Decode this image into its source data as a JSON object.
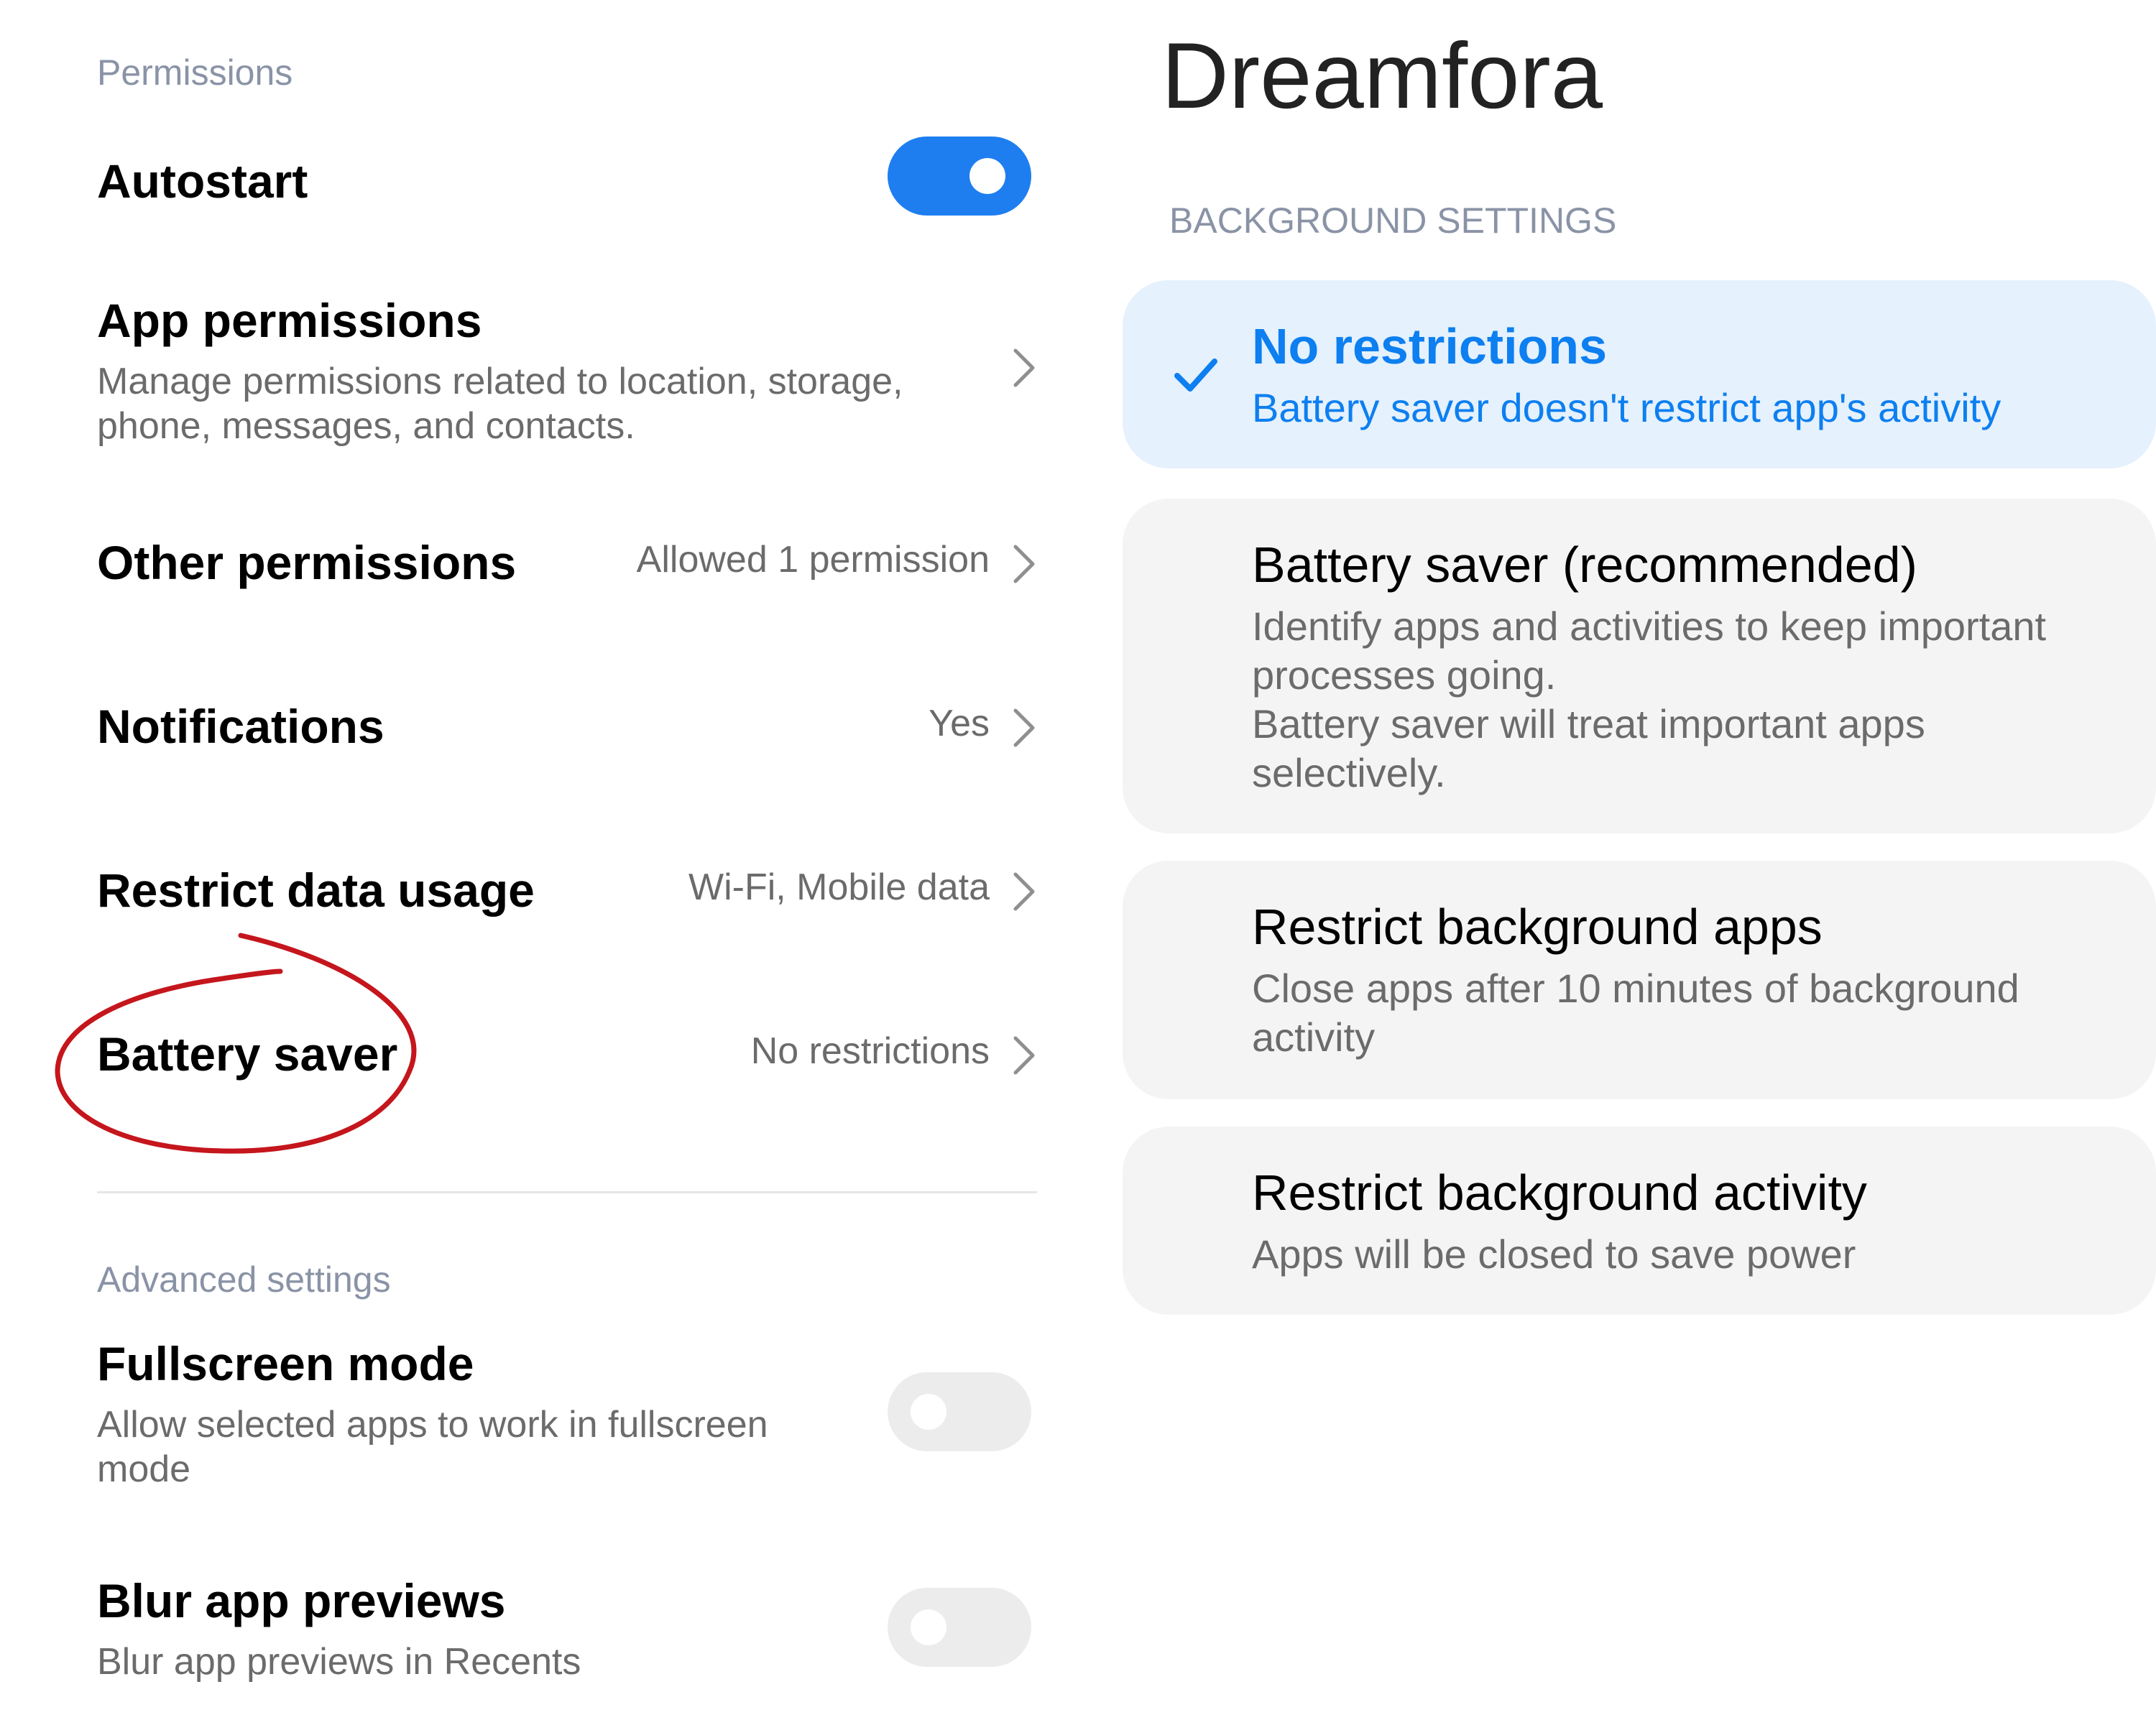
{
  "left": {
    "permissions_label": "Permissions",
    "autostart": {
      "title": "Autostart",
      "enabled": true
    },
    "app_permissions": {
      "title": "App permissions",
      "desc": "Manage permissions related to location, storage, phone, messages, and contacts."
    },
    "other_permissions": {
      "title": "Other permissions",
      "value": "Allowed 1 permission"
    },
    "notifications": {
      "title": "Notifications",
      "value": "Yes"
    },
    "restrict_data": {
      "title": "Restrict data usage",
      "value": "Wi-Fi, Mobile data"
    },
    "battery_saver": {
      "title": "Battery saver",
      "value": "No restrictions"
    },
    "advanced_label": "Advanced settings",
    "fullscreen": {
      "title": "Fullscreen mode",
      "desc": "Allow selected apps to work in fullscreen mode",
      "enabled": false
    },
    "blur": {
      "title": "Blur app previews",
      "desc": "Blur app previews in Recents",
      "enabled": false
    }
  },
  "right": {
    "app_title": "Dreamfora",
    "section_label": "BACKGROUND SETTINGS",
    "options": [
      {
        "title": "No restrictions",
        "desc": "Battery saver doesn't restrict app's activity",
        "selected": true
      },
      {
        "title": "Battery saver (recommended)",
        "desc1": "Identify apps and activities to keep important processes going.",
        "desc2": "Battery saver will treat important apps selectively.",
        "selected": false
      },
      {
        "title": "Restrict background apps",
        "desc": "Close apps after 10 minutes of background activity",
        "selected": false
      },
      {
        "title": "Restrict background activity",
        "desc": "Apps will be closed to save power",
        "selected": false
      }
    ]
  },
  "colors": {
    "accent": "#1e7ef0",
    "selected_text": "#0d7ff0",
    "annotation": "#c4161c"
  },
  "icons": {
    "chevron": "chevron-right-icon",
    "check": "checkmark-icon"
  }
}
